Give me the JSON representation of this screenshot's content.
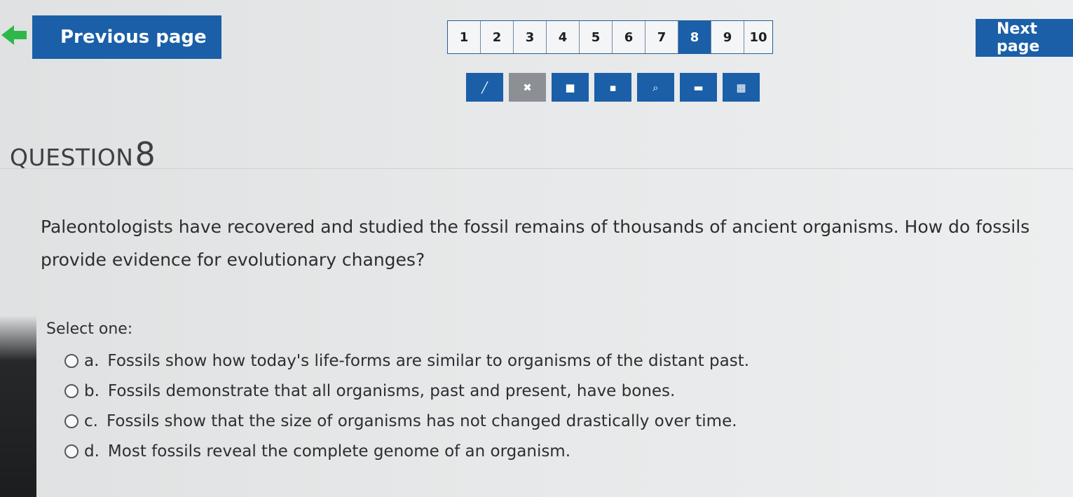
{
  "nav": {
    "previous_label": "Previous page",
    "next_label": "Next page",
    "pages": [
      "1",
      "2",
      "3",
      "4",
      "5",
      "6",
      "7",
      "8",
      "9",
      "10"
    ],
    "current_page": "8"
  },
  "toolbar": {
    "tools": [
      {
        "icon": "pencil-icon",
        "glyph": "╱"
      },
      {
        "icon": "eraser-close-icon",
        "glyph": "✖"
      },
      {
        "icon": "bookmark-icon",
        "glyph": "■"
      },
      {
        "icon": "highlighter-icon",
        "glyph": "▪"
      },
      {
        "icon": "magnifier-icon",
        "glyph": "⌕"
      },
      {
        "icon": "line-reader-icon",
        "glyph": "▬"
      },
      {
        "icon": "calculator-icon",
        "glyph": "▦"
      }
    ]
  },
  "question": {
    "label": "QUESTION",
    "number": "8",
    "text": "Paleontologists have recovered and studied the fossil remains of thousands of ancient organisms. How do fossils provide evidence for evolutionary changes?",
    "prompt": "Select one:",
    "options": [
      {
        "letter": "a.",
        "text": "Fossils show how today's life-forms are similar to organisms of the distant past."
      },
      {
        "letter": "b.",
        "text": "Fossils demonstrate that all organisms, past and present, have bones."
      },
      {
        "letter": "c.",
        "text": "Fossils show that the size of organisms has not changed drastically over time."
      },
      {
        "letter": "d.",
        "text": "Most fossils reveal the complete genome of an organism."
      }
    ]
  },
  "colors": {
    "accent": "#1a5fa8",
    "tool_gray": "#8c9094",
    "arrow_green": "#2eb84a"
  }
}
